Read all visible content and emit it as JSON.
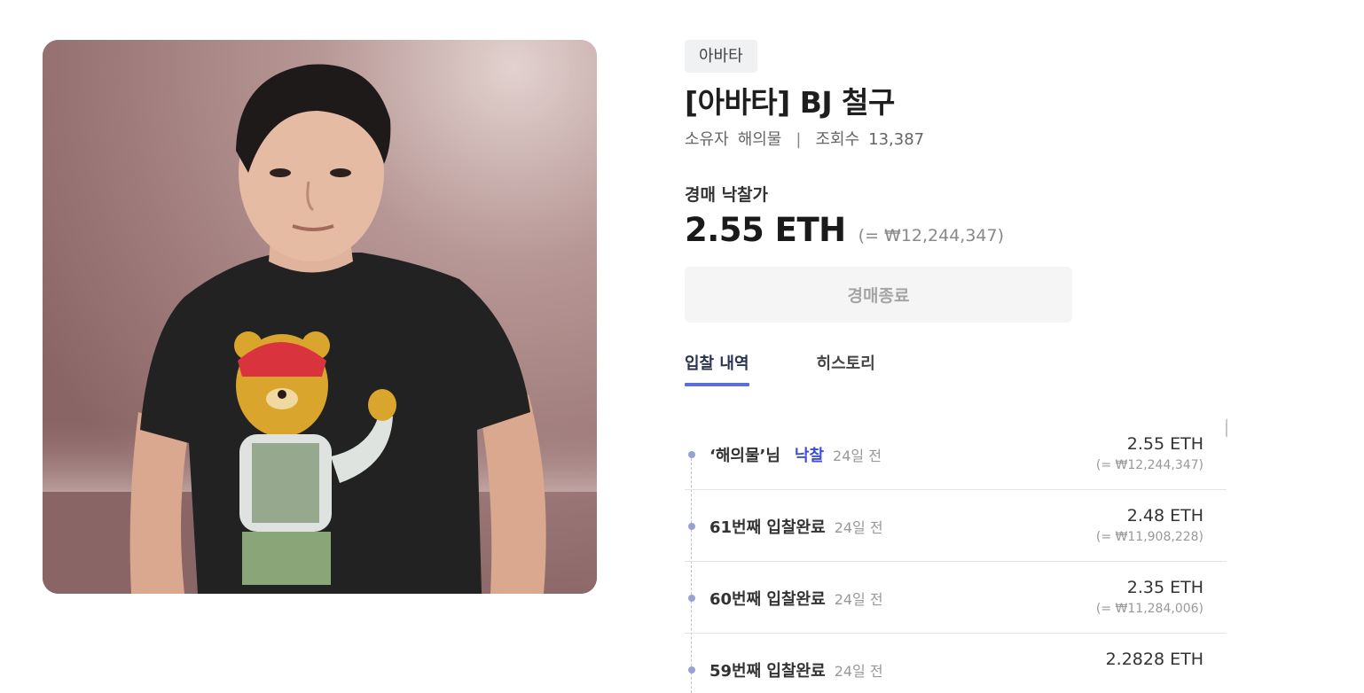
{
  "artwork": {
    "alt": "avatar-portrait"
  },
  "item": {
    "category": "아바타",
    "title": "[아바타] BJ 철구",
    "owner_label": "소유자",
    "owner_name": "해의물",
    "separator": "|",
    "views_label": "조회수",
    "views_count": "13,387"
  },
  "price": {
    "label": "경매 낙찰가",
    "eth": "2.55 ETH",
    "krw": "(= ₩12,244,347)"
  },
  "auction_button": "경매종료",
  "tabs": [
    {
      "label": "입찰 내역",
      "active": true
    },
    {
      "label": "히스토리",
      "active": false
    }
  ],
  "bids": [
    {
      "name": "‘해의물’님",
      "tag": "낙찰",
      "time": "24일 전",
      "eth": "2.55 ETH",
      "krw": "(= ₩12,244,347)"
    },
    {
      "name": "61번째 입찰완료",
      "tag": "",
      "time": "24일 전",
      "eth": "2.48 ETH",
      "krw": "(= ₩11,908,228)"
    },
    {
      "name": "60번째 입찰완료",
      "tag": "",
      "time": "24일 전",
      "eth": "2.35 ETH",
      "krw": "(= ₩11,284,006)"
    },
    {
      "name": "59번째 입찰완료",
      "tag": "",
      "time": "24일 전",
      "eth": "2.2828 ETH",
      "krw": ""
    }
  ],
  "colors": {
    "accent": "#5c6fd6",
    "won_tag": "#3c4fd8",
    "timeline_dot": "#98a1d3"
  }
}
